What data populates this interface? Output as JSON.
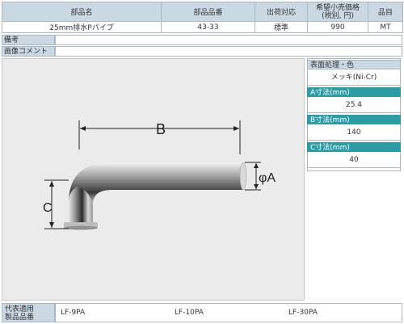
{
  "header": {
    "col_name": "部品名",
    "col_part_no": "部品品番",
    "col_shipping": "出荷対応",
    "col_price": "希望小売価格\n(税別, 円)",
    "col_price_line1": "希望小売価格",
    "col_price_line2": "(税別, 円)",
    "col_type": "品目"
  },
  "row": {
    "name": "25mm排水Pパイプ",
    "part_no": "43-33",
    "shipping": "標準",
    "price": "990",
    "type": "MT"
  },
  "remarks": {
    "label": "備考",
    "value": ""
  },
  "image_comment": {
    "label": "画像コメント",
    "value": ""
  },
  "diagram": {
    "label_b": "B",
    "label_c": "C",
    "label_a": "φA"
  },
  "specs": {
    "surface_label": "表面処理・色",
    "surface_value": "メッキ(Ni-Cr)",
    "a_label": "A寸法(mm)",
    "a_value": "25.4",
    "b_label": "B寸法(mm)",
    "b_value": "140",
    "c_label": "C寸法(mm)",
    "c_value": "40"
  },
  "applicable": {
    "label_line1": "代表適用",
    "label_line2": "製品品番",
    "models": [
      "LF-9PA",
      "LF-10PA",
      "LF-30PA"
    ]
  },
  "colors": {
    "header_bg": "#c9d8e3",
    "accent": "#2b9ba6",
    "border": "#aab8c4"
  }
}
